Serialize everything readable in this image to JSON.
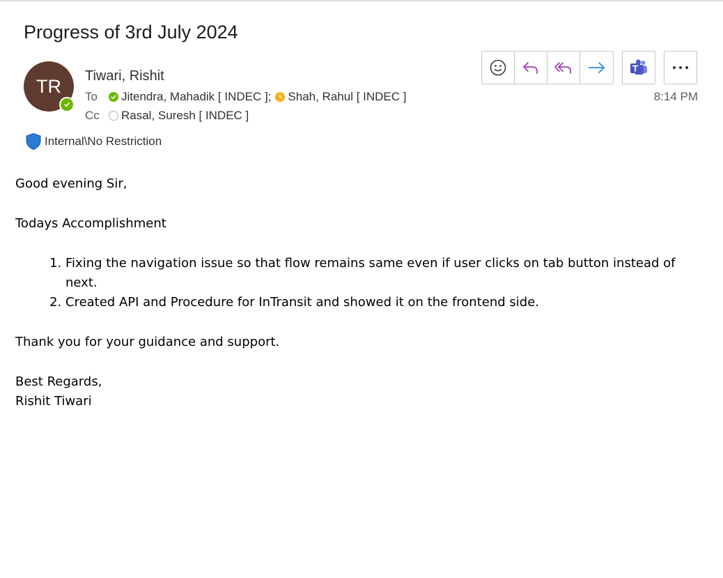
{
  "email": {
    "subject": "Progress of 3rd July 2024",
    "sender": {
      "initials": "TR",
      "name": "Tiwari, Rishit",
      "avatar_color": "#5f3b2f",
      "presence": "available"
    },
    "to_label": "To",
    "to": [
      {
        "name": "Jitendra, Mahadik [ INDEC ];",
        "status": "available"
      },
      {
        "name": "Shah, Rahul [ INDEC ]",
        "status": "away"
      }
    ],
    "cc_label": "Cc",
    "cc": [
      {
        "name": "Rasal, Suresh [ INDEC ]",
        "status": "offline"
      }
    ],
    "time": "8:14 PM",
    "sensitivity": "Internal\\No Restriction"
  },
  "toolbar": {
    "icons": [
      "emoji-icon",
      "reply-icon",
      "reply-all-icon",
      "forward-icon",
      "teams-icon",
      "more-icon"
    ]
  },
  "body": {
    "greeting": "Good evening Sir,",
    "heading": "Todays Accomplishment",
    "items": [
      "Fixing the navigation issue so that flow remains same even if user clicks on tab button instead of next.",
      "Created API and Procedure for InTransit and showed it on the frontend side."
    ],
    "thanks": "Thank you for your guidance and support.",
    "closing": "Best Regards,",
    "signature": "Rishit Tiwari"
  },
  "colors": {
    "available": "#6bb700",
    "away": "#f8b010",
    "reply_purple": "#a33ab8",
    "forward_blue": "#2b88d8",
    "shield_blue": "#2b7cd3"
  }
}
